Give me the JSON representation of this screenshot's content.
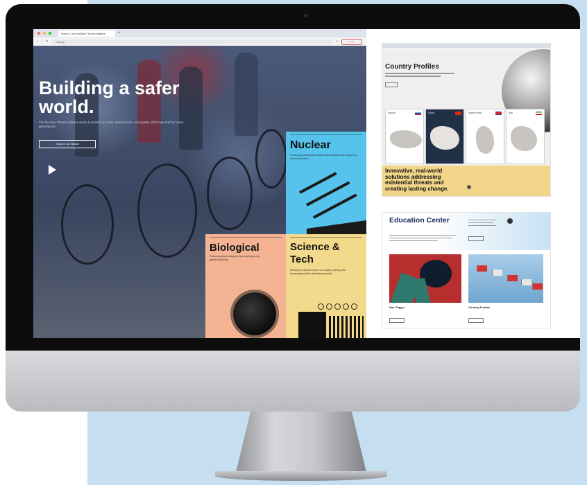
{
  "browser": {
    "tab_title": "Home | The Nuclear Threat Initiative",
    "url": "nti.org",
    "toolbar_button": "Donate"
  },
  "hero": {
    "title": "Building a safer world.",
    "subtitle": "The Nuclear Threat Initiative works to protect our lives, environment, and quality of life now and for future generations.",
    "cta": "Explore our impact"
  },
  "panels": [
    {
      "title": "Nuclear",
      "text": "Preventing catastrophic attacks and accidents with weapons of mass destruction."
    },
    {
      "title": "Biological",
      "text": "Reducing global biological risks and improving global biosecurity."
    },
    {
      "title": "Science & Tech",
      "text": "Working to minimize risks from rapidly evolving new technologies while maximizing benefits."
    }
  ],
  "country_profiles": {
    "title": "Country Profiles",
    "countries": [
      "Russia",
      "China",
      "North Korea",
      "Iran"
    ],
    "banner": "Innovative, real-world solutions addressing existential threats and creating lasting change."
  },
  "education_center": {
    "title": "Education Center",
    "items": [
      "Hair Trigger",
      "Country Profiles"
    ]
  },
  "colors": {
    "nuclear": "#56c3ec",
    "biological": "#f4b493",
    "science": "#f3d98c",
    "backdrop": "#c6dff0"
  }
}
